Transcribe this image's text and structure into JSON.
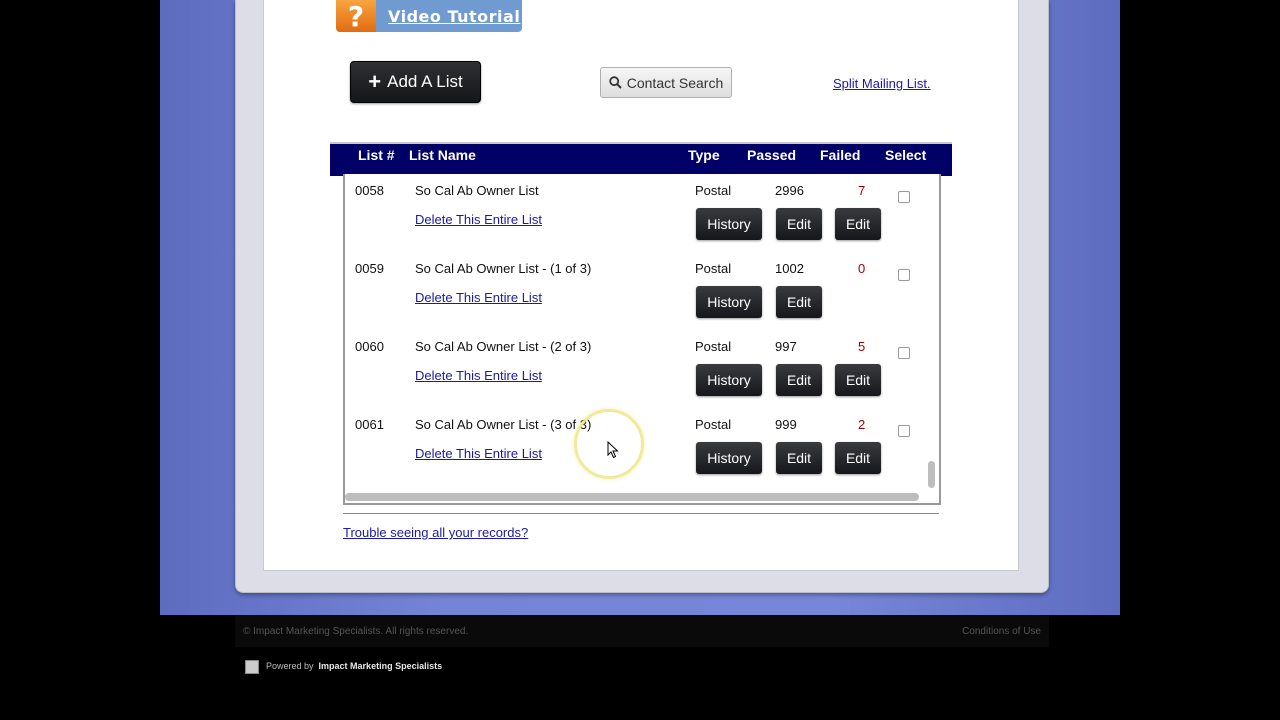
{
  "video_tutorial": {
    "icon": "?",
    "label": "Video Tutorial"
  },
  "toolbar": {
    "add_list_icon": "+",
    "add_list_label": "Add A List",
    "contact_search_label": "Contact Search",
    "split_mailing_label": "Split Mailing List."
  },
  "grid": {
    "headers": {
      "list_num": "List #",
      "list_name": "List Name",
      "type": "Type",
      "passed": "Passed",
      "failed": "Failed",
      "select": "Select"
    },
    "rows": [
      {
        "num": "0058",
        "name": "So Cal Ab Owner List",
        "delete": "Delete This Entire List",
        "type": "Postal",
        "passed": "2996",
        "failed": "7",
        "history": "History",
        "edit1": "Edit",
        "edit2": "Edit"
      },
      {
        "num": "0059",
        "name": "So Cal Ab Owner List - (1 of 3)",
        "delete": "Delete This Entire List",
        "type": "Postal",
        "passed": "1002",
        "failed": "0",
        "history": "History",
        "edit1": "Edit",
        "edit2": ""
      },
      {
        "num": "0060",
        "name": "So Cal Ab Owner List - (2 of 3)",
        "delete": "Delete This Entire List",
        "type": "Postal",
        "passed": "997",
        "failed": "5",
        "history": "History",
        "edit1": "Edit",
        "edit2": "Edit"
      },
      {
        "num": "0061",
        "name": "So Cal Ab Owner List - (3 of 3)",
        "delete": "Delete This Entire List",
        "type": "Postal",
        "passed": "999",
        "failed": "2",
        "history": "History",
        "edit1": "Edit",
        "edit2": "Edit"
      }
    ]
  },
  "trouble_link": "Trouble seeing all your records?",
  "footer": {
    "copyright": "© Impact Marketing Specialists. All rights reserved.",
    "conditions": "Conditions of Use",
    "powered_prefix": "Powered by",
    "powered_name": "Impact Marketing Specialists"
  },
  "colors": {
    "header_bg": "#000066",
    "failed_text": "#9c0000",
    "link": "#1a1aa6",
    "video_orange": "#f08a24",
    "video_blue": "#6f9bd0"
  }
}
